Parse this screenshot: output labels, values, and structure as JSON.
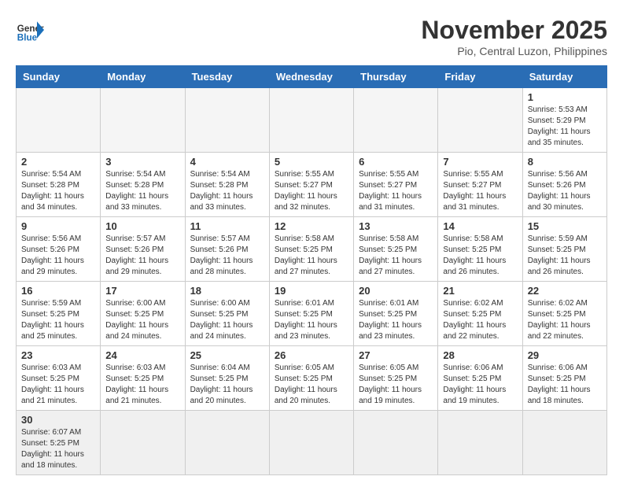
{
  "header": {
    "logo_general": "General",
    "logo_blue": "Blue",
    "month_title": "November 2025",
    "location": "Pio, Central Luzon, Philippines"
  },
  "weekdays": [
    "Sunday",
    "Monday",
    "Tuesday",
    "Wednesday",
    "Thursday",
    "Friday",
    "Saturday"
  ],
  "weeks": [
    [
      {
        "day": "",
        "empty": true
      },
      {
        "day": "",
        "empty": true
      },
      {
        "day": "",
        "empty": true
      },
      {
        "day": "",
        "empty": true
      },
      {
        "day": "",
        "empty": true
      },
      {
        "day": "",
        "empty": true
      },
      {
        "day": "1",
        "sunrise": "5:53 AM",
        "sunset": "5:29 PM",
        "daylight": "11 hours and 35 minutes."
      }
    ],
    [
      {
        "day": "2",
        "sunrise": "5:54 AM",
        "sunset": "5:28 PM",
        "daylight": "11 hours and 34 minutes."
      },
      {
        "day": "3",
        "sunrise": "5:54 AM",
        "sunset": "5:28 PM",
        "daylight": "11 hours and 33 minutes."
      },
      {
        "day": "4",
        "sunrise": "5:54 AM",
        "sunset": "5:28 PM",
        "daylight": "11 hours and 33 minutes."
      },
      {
        "day": "5",
        "sunrise": "5:55 AM",
        "sunset": "5:27 PM",
        "daylight": "11 hours and 32 minutes."
      },
      {
        "day": "6",
        "sunrise": "5:55 AM",
        "sunset": "5:27 PM",
        "daylight": "11 hours and 31 minutes."
      },
      {
        "day": "7",
        "sunrise": "5:55 AM",
        "sunset": "5:27 PM",
        "daylight": "11 hours and 31 minutes."
      },
      {
        "day": "8",
        "sunrise": "5:56 AM",
        "sunset": "5:26 PM",
        "daylight": "11 hours and 30 minutes."
      }
    ],
    [
      {
        "day": "9",
        "sunrise": "5:56 AM",
        "sunset": "5:26 PM",
        "daylight": "11 hours and 29 minutes."
      },
      {
        "day": "10",
        "sunrise": "5:57 AM",
        "sunset": "5:26 PM",
        "daylight": "11 hours and 29 minutes."
      },
      {
        "day": "11",
        "sunrise": "5:57 AM",
        "sunset": "5:26 PM",
        "daylight": "11 hours and 28 minutes."
      },
      {
        "day": "12",
        "sunrise": "5:58 AM",
        "sunset": "5:25 PM",
        "daylight": "11 hours and 27 minutes."
      },
      {
        "day": "13",
        "sunrise": "5:58 AM",
        "sunset": "5:25 PM",
        "daylight": "11 hours and 27 minutes."
      },
      {
        "day": "14",
        "sunrise": "5:58 AM",
        "sunset": "5:25 PM",
        "daylight": "11 hours and 26 minutes."
      },
      {
        "day": "15",
        "sunrise": "5:59 AM",
        "sunset": "5:25 PM",
        "daylight": "11 hours and 26 minutes."
      }
    ],
    [
      {
        "day": "16",
        "sunrise": "5:59 AM",
        "sunset": "5:25 PM",
        "daylight": "11 hours and 25 minutes."
      },
      {
        "day": "17",
        "sunrise": "6:00 AM",
        "sunset": "5:25 PM",
        "daylight": "11 hours and 24 minutes."
      },
      {
        "day": "18",
        "sunrise": "6:00 AM",
        "sunset": "5:25 PM",
        "daylight": "11 hours and 24 minutes."
      },
      {
        "day": "19",
        "sunrise": "6:01 AM",
        "sunset": "5:25 PM",
        "daylight": "11 hours and 23 minutes."
      },
      {
        "day": "20",
        "sunrise": "6:01 AM",
        "sunset": "5:25 PM",
        "daylight": "11 hours and 23 minutes."
      },
      {
        "day": "21",
        "sunrise": "6:02 AM",
        "sunset": "5:25 PM",
        "daylight": "11 hours and 22 minutes."
      },
      {
        "day": "22",
        "sunrise": "6:02 AM",
        "sunset": "5:25 PM",
        "daylight": "11 hours and 22 minutes."
      }
    ],
    [
      {
        "day": "23",
        "sunrise": "6:03 AM",
        "sunset": "5:25 PM",
        "daylight": "11 hours and 21 minutes."
      },
      {
        "day": "24",
        "sunrise": "6:03 AM",
        "sunset": "5:25 PM",
        "daylight": "11 hours and 21 minutes."
      },
      {
        "day": "25",
        "sunrise": "6:04 AM",
        "sunset": "5:25 PM",
        "daylight": "11 hours and 20 minutes."
      },
      {
        "day": "26",
        "sunrise": "6:05 AM",
        "sunset": "5:25 PM",
        "daylight": "11 hours and 20 minutes."
      },
      {
        "day": "27",
        "sunrise": "6:05 AM",
        "sunset": "5:25 PM",
        "daylight": "11 hours and 19 minutes."
      },
      {
        "day": "28",
        "sunrise": "6:06 AM",
        "sunset": "5:25 PM",
        "daylight": "11 hours and 19 minutes."
      },
      {
        "day": "29",
        "sunrise": "6:06 AM",
        "sunset": "5:25 PM",
        "daylight": "11 hours and 18 minutes."
      }
    ],
    [
      {
        "day": "30",
        "sunrise": "6:07 AM",
        "sunset": "5:25 PM",
        "daylight": "11 hours and 18 minutes.",
        "last": true
      },
      {
        "day": "",
        "empty": true,
        "last": true
      },
      {
        "day": "",
        "empty": true,
        "last": true
      },
      {
        "day": "",
        "empty": true,
        "last": true
      },
      {
        "day": "",
        "empty": true,
        "last": true
      },
      {
        "day": "",
        "empty": true,
        "last": true
      },
      {
        "day": "",
        "empty": true,
        "last": true
      }
    ]
  ]
}
